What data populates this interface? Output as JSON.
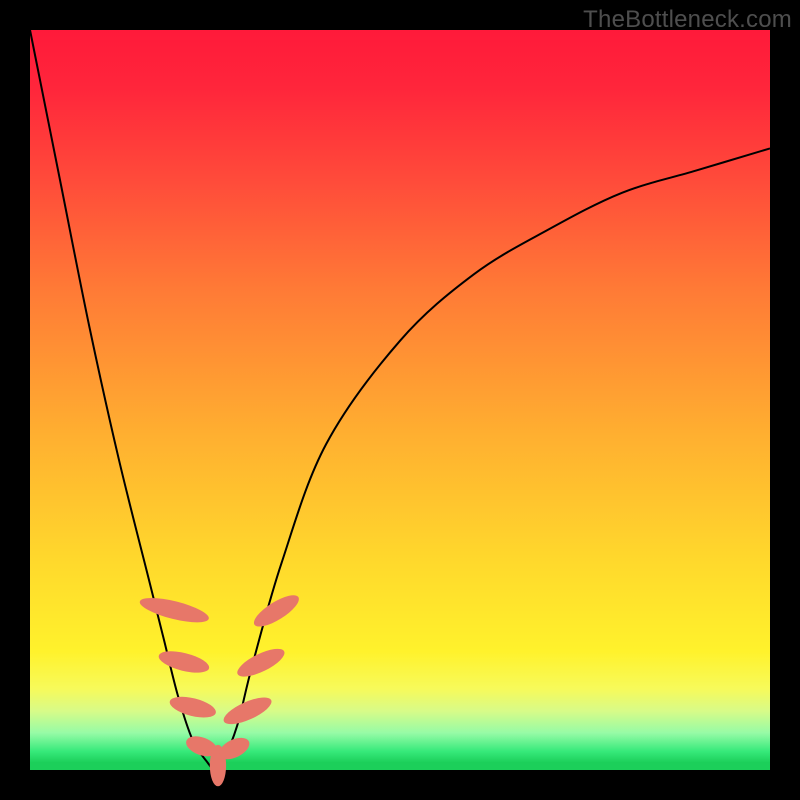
{
  "watermark": "TheBottleneck.com",
  "colors": {
    "frame": "#000000",
    "gradient_top": "#ff1a3a",
    "gradient_bottom": "#1ccf5a",
    "curve": "#000000",
    "marker": "#e77769"
  },
  "chart_data": {
    "type": "line",
    "title": "",
    "xlabel": "",
    "ylabel": "",
    "xlim": [
      0,
      100
    ],
    "ylim": [
      0,
      100
    ],
    "series": [
      {
        "name": "bottleneck-curve",
        "x": [
          0,
          4,
          8,
          12,
          16,
          18,
          20,
          22,
          24,
          25,
          26,
          28,
          30,
          34,
          40,
          50,
          60,
          70,
          80,
          90,
          100
        ],
        "y": [
          100,
          80,
          60,
          42,
          26,
          18,
          10,
          4,
          1,
          0,
          1,
          6,
          14,
          28,
          44,
          58,
          67,
          73,
          78,
          81,
          84
        ]
      }
    ],
    "annotations": {
      "markers": [
        {
          "x": 19.5,
          "y": 21.6,
          "rx": 1.2,
          "ry": 4.8,
          "rot": -76
        },
        {
          "x": 20.8,
          "y": 14.6,
          "rx": 1.2,
          "ry": 3.5,
          "rot": -76
        },
        {
          "x": 22.0,
          "y": 8.5,
          "rx": 1.2,
          "ry": 3.2,
          "rot": -76
        },
        {
          "x": 23.2,
          "y": 3.2,
          "rx": 1.2,
          "ry": 2.2,
          "rot": -70
        },
        {
          "x": 25.4,
          "y": 0.6,
          "rx": 1.1,
          "ry": 2.8,
          "rot": 0
        },
        {
          "x": 27.6,
          "y": 2.9,
          "rx": 1.2,
          "ry": 2.2,
          "rot": 64
        },
        {
          "x": 29.4,
          "y": 8.0,
          "rx": 1.2,
          "ry": 3.5,
          "rot": 66
        },
        {
          "x": 31.2,
          "y": 14.5,
          "rx": 1.2,
          "ry": 3.5,
          "rot": 64
        },
        {
          "x": 33.3,
          "y": 21.5,
          "rx": 1.2,
          "ry": 3.5,
          "rot": 58
        }
      ]
    }
  }
}
